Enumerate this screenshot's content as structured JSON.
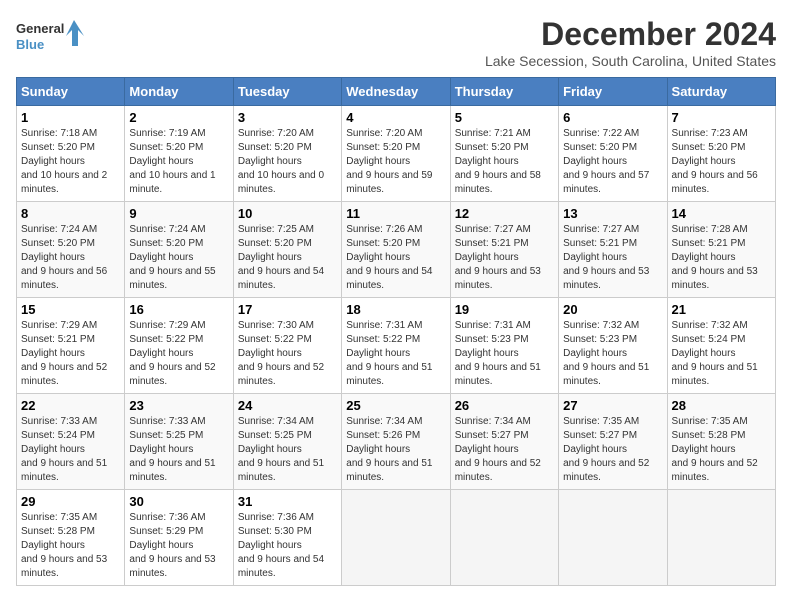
{
  "logo": {
    "line1": "General",
    "line2": "Blue"
  },
  "title": "December 2024",
  "subtitle": "Lake Secession, South Carolina, United States",
  "days_of_week": [
    "Sunday",
    "Monday",
    "Tuesday",
    "Wednesday",
    "Thursday",
    "Friday",
    "Saturday"
  ],
  "weeks": [
    [
      {
        "day": "1",
        "sunrise": "7:18 AM",
        "sunset": "5:20 PM",
        "daylight": "10 hours and 2 minutes."
      },
      {
        "day": "2",
        "sunrise": "7:19 AM",
        "sunset": "5:20 PM",
        "daylight": "10 hours and 1 minute."
      },
      {
        "day": "3",
        "sunrise": "7:20 AM",
        "sunset": "5:20 PM",
        "daylight": "10 hours and 0 minutes."
      },
      {
        "day": "4",
        "sunrise": "7:20 AM",
        "sunset": "5:20 PM",
        "daylight": "9 hours and 59 minutes."
      },
      {
        "day": "5",
        "sunrise": "7:21 AM",
        "sunset": "5:20 PM",
        "daylight": "9 hours and 58 minutes."
      },
      {
        "day": "6",
        "sunrise": "7:22 AM",
        "sunset": "5:20 PM",
        "daylight": "9 hours and 57 minutes."
      },
      {
        "day": "7",
        "sunrise": "7:23 AM",
        "sunset": "5:20 PM",
        "daylight": "9 hours and 56 minutes."
      }
    ],
    [
      {
        "day": "8",
        "sunrise": "7:24 AM",
        "sunset": "5:20 PM",
        "daylight": "9 hours and 56 minutes."
      },
      {
        "day": "9",
        "sunrise": "7:24 AM",
        "sunset": "5:20 PM",
        "daylight": "9 hours and 55 minutes."
      },
      {
        "day": "10",
        "sunrise": "7:25 AM",
        "sunset": "5:20 PM",
        "daylight": "9 hours and 54 minutes."
      },
      {
        "day": "11",
        "sunrise": "7:26 AM",
        "sunset": "5:20 PM",
        "daylight": "9 hours and 54 minutes."
      },
      {
        "day": "12",
        "sunrise": "7:27 AM",
        "sunset": "5:21 PM",
        "daylight": "9 hours and 53 minutes."
      },
      {
        "day": "13",
        "sunrise": "7:27 AM",
        "sunset": "5:21 PM",
        "daylight": "9 hours and 53 minutes."
      },
      {
        "day": "14",
        "sunrise": "7:28 AM",
        "sunset": "5:21 PM",
        "daylight": "9 hours and 53 minutes."
      }
    ],
    [
      {
        "day": "15",
        "sunrise": "7:29 AM",
        "sunset": "5:21 PM",
        "daylight": "9 hours and 52 minutes."
      },
      {
        "day": "16",
        "sunrise": "7:29 AM",
        "sunset": "5:22 PM",
        "daylight": "9 hours and 52 minutes."
      },
      {
        "day": "17",
        "sunrise": "7:30 AM",
        "sunset": "5:22 PM",
        "daylight": "9 hours and 52 minutes."
      },
      {
        "day": "18",
        "sunrise": "7:31 AM",
        "sunset": "5:22 PM",
        "daylight": "9 hours and 51 minutes."
      },
      {
        "day": "19",
        "sunrise": "7:31 AM",
        "sunset": "5:23 PM",
        "daylight": "9 hours and 51 minutes."
      },
      {
        "day": "20",
        "sunrise": "7:32 AM",
        "sunset": "5:23 PM",
        "daylight": "9 hours and 51 minutes."
      },
      {
        "day": "21",
        "sunrise": "7:32 AM",
        "sunset": "5:24 PM",
        "daylight": "9 hours and 51 minutes."
      }
    ],
    [
      {
        "day": "22",
        "sunrise": "7:33 AM",
        "sunset": "5:24 PM",
        "daylight": "9 hours and 51 minutes."
      },
      {
        "day": "23",
        "sunrise": "7:33 AM",
        "sunset": "5:25 PM",
        "daylight": "9 hours and 51 minutes."
      },
      {
        "day": "24",
        "sunrise": "7:34 AM",
        "sunset": "5:25 PM",
        "daylight": "9 hours and 51 minutes."
      },
      {
        "day": "25",
        "sunrise": "7:34 AM",
        "sunset": "5:26 PM",
        "daylight": "9 hours and 51 minutes."
      },
      {
        "day": "26",
        "sunrise": "7:34 AM",
        "sunset": "5:27 PM",
        "daylight": "9 hours and 52 minutes."
      },
      {
        "day": "27",
        "sunrise": "7:35 AM",
        "sunset": "5:27 PM",
        "daylight": "9 hours and 52 minutes."
      },
      {
        "day": "28",
        "sunrise": "7:35 AM",
        "sunset": "5:28 PM",
        "daylight": "9 hours and 52 minutes."
      }
    ],
    [
      {
        "day": "29",
        "sunrise": "7:35 AM",
        "sunset": "5:28 PM",
        "daylight": "9 hours and 53 minutes."
      },
      {
        "day": "30",
        "sunrise": "7:36 AM",
        "sunset": "5:29 PM",
        "daylight": "9 hours and 53 minutes."
      },
      {
        "day": "31",
        "sunrise": "7:36 AM",
        "sunset": "5:30 PM",
        "daylight": "9 hours and 54 minutes."
      },
      null,
      null,
      null,
      null
    ]
  ],
  "labels": {
    "sunrise": "Sunrise:",
    "sunset": "Sunset:",
    "daylight": "Daylight hours"
  }
}
